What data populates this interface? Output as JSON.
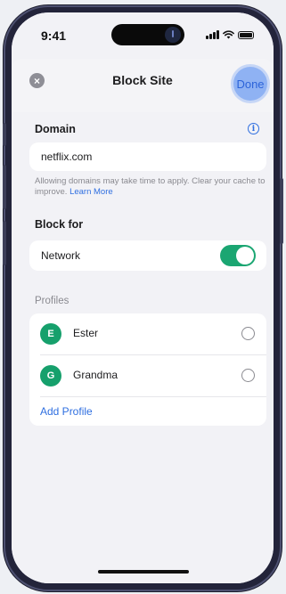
{
  "status_bar": {
    "time": "9:41"
  },
  "header": {
    "title": "Block Site",
    "close_icon": "×",
    "done_label": "Done"
  },
  "domain": {
    "label": "Domain",
    "value": "netflix.com",
    "help_text": "Allowing domains may take time to apply. Clear your cache to improve.",
    "learn_more": "Learn More"
  },
  "block_for": {
    "label": "Block for",
    "network_label": "Network",
    "network_enabled": true
  },
  "profiles": {
    "label": "Profiles",
    "items": [
      {
        "initial": "E",
        "name": "Ester",
        "selected": false
      },
      {
        "initial": "G",
        "name": "Grandma",
        "selected": false
      }
    ],
    "add_label": "Add Profile"
  },
  "colors": {
    "accent": "#2f6fe0",
    "done_bg": "#8fb2f3",
    "toggle_on": "#1ba672",
    "avatar": "#16a06c"
  },
  "icons": [
    "close-icon",
    "info-icon",
    "signal-icon",
    "wifi-icon",
    "battery-icon"
  ]
}
